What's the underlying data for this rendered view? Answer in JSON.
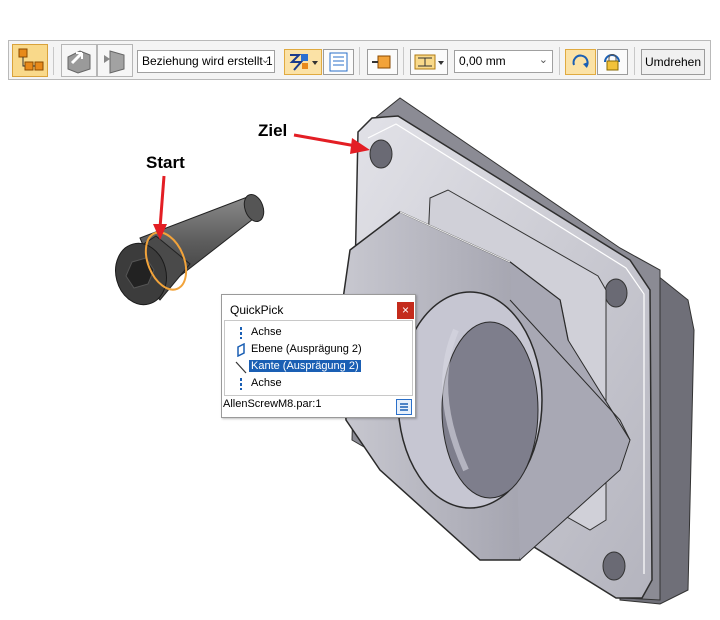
{
  "toolbar": {
    "relationship_combo": "Beziehung wird erstellt 1",
    "offset_value": "0,00 mm",
    "flip_button": "Umdrehen"
  },
  "scene": {
    "label_start": "Start",
    "label_target": "Ziel"
  },
  "quickpick": {
    "title": "QuickPick",
    "items": [
      {
        "label": "Achse",
        "icon": "axis-icon",
        "selected": false
      },
      {
        "label": "Ebene (Ausprägung 2)",
        "icon": "plane-icon",
        "selected": false
      },
      {
        "label": "Kante (Ausprägung 2)",
        "icon": "edge-icon",
        "selected": true
      },
      {
        "label": "Achse",
        "icon": "axis-icon",
        "selected": false
      }
    ],
    "status": "AllenScrewM8.par:1"
  },
  "colors": {
    "highlight_orange": "#f2a33a",
    "arrow_red": "#e31e24",
    "selection_blue": "#1a5fb4",
    "close_red": "#c42b1c"
  }
}
